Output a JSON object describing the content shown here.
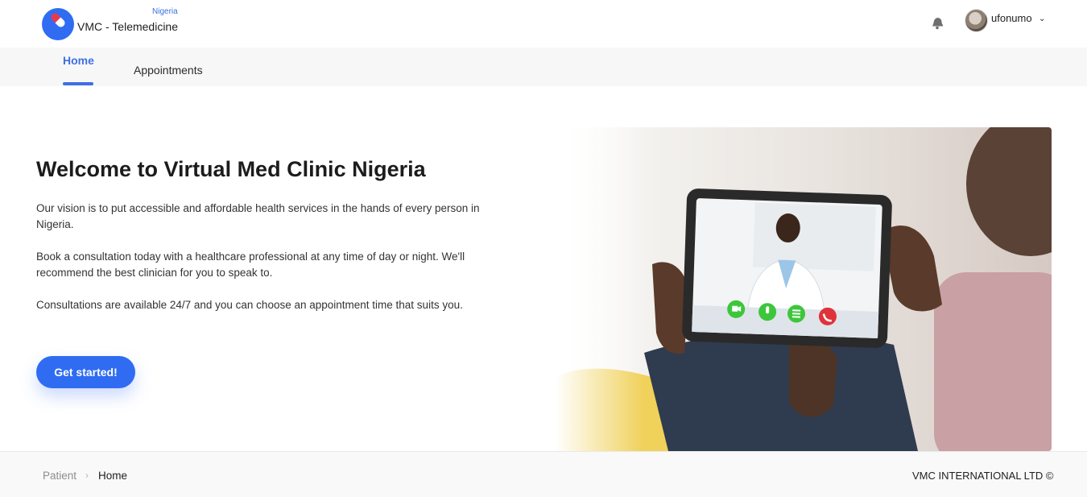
{
  "header": {
    "logo_region": "Nigeria",
    "logo_name": "VMC - Telemedicine",
    "username": "ufonumo",
    "icons": {
      "notifications": "bell-icon",
      "account_menu": "chevron-down-icon",
      "logo": "pill-icon"
    }
  },
  "tabs": [
    {
      "label": "Home",
      "active": true
    },
    {
      "label": "Appointments",
      "active": false
    }
  ],
  "main": {
    "title": "Welcome to Virtual Med Clinic Nigeria",
    "paragraphs": [
      "Our vision is to put accessible and affordable health services in the hands of every person in Nigeria.",
      "Book a consultation today with a healthcare professional at any time of day or night. We'll recommend the best clinician for you to speak to.",
      "Consultations are available 24/7 and you can choose an appointment time that suits you."
    ],
    "cta_label": "Get started!"
  },
  "footer": {
    "breadcrumb": [
      "Patient",
      "Home"
    ],
    "breadcrumb_separator": "›",
    "copyright": "VMC INTERNATIONAL LTD ©"
  },
  "colors": {
    "accent": "#2f6cf2",
    "tab_active": "#3f6fe4",
    "call_end": "#e0323b",
    "call_controls": "#3cc63c"
  }
}
